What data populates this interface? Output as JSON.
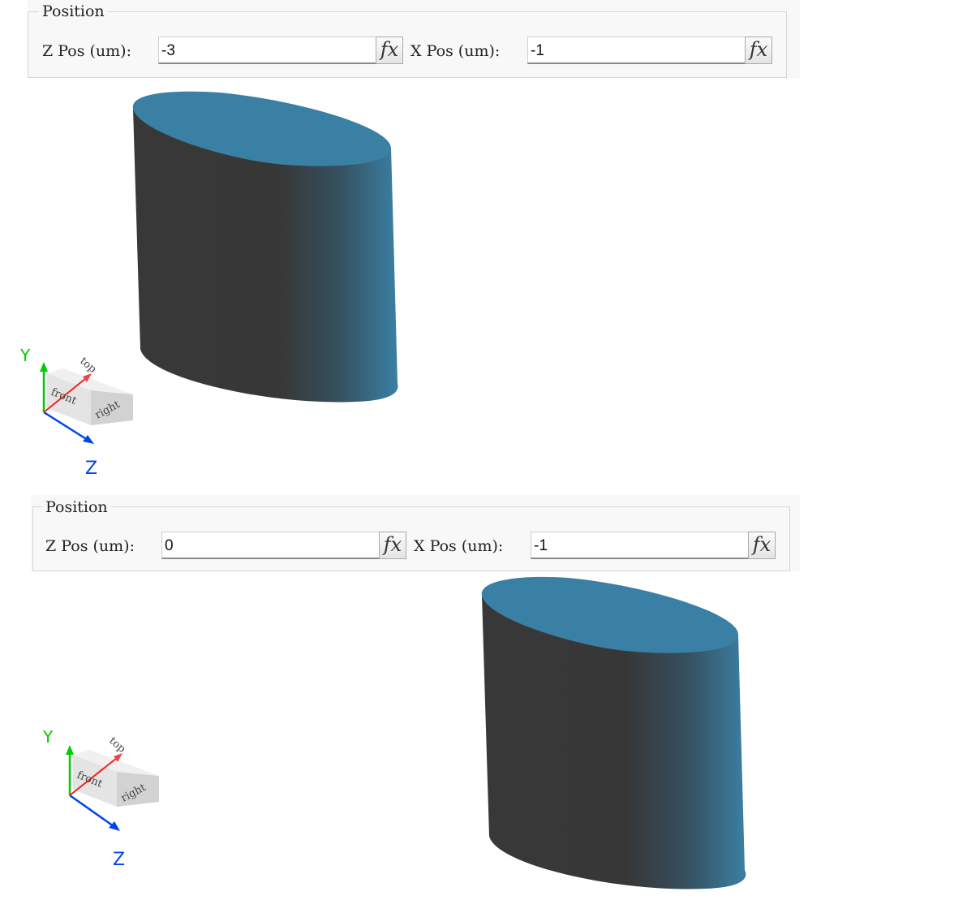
{
  "panels": [
    {
      "legend": "Position",
      "z_label": "Z Pos (um):",
      "z_value": "-3",
      "x_label": "X Pos (um):",
      "x_value": "-1",
      "fx_label": "fx"
    },
    {
      "legend": "Position",
      "z_label": "Z Pos (um):",
      "z_value": "0",
      "x_label": "X Pos (um):",
      "x_value": "-1",
      "fx_label": "fx"
    }
  ],
  "triad": {
    "y_label": "Y",
    "z_label": "Z",
    "top_label": "top",
    "front_label": "front",
    "right_label": "right"
  },
  "colors": {
    "cylinder_top": "#3a80a4",
    "cylinder_dark": "#373737",
    "axis_y": "#00cc00",
    "axis_z": "#0044ee",
    "axis_x": "#ee2222"
  }
}
